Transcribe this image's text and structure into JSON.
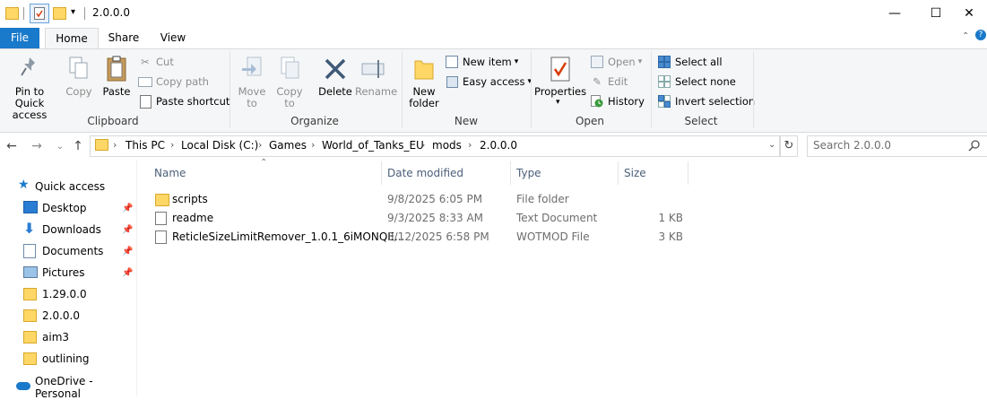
{
  "window": {
    "title": "2.0.0.0"
  },
  "ribbon_tabs": {
    "file": "File",
    "home": "Home",
    "share": "Share",
    "view": "View"
  },
  "clipboard": {
    "pin_to_quick_access": "Pin to Quick access",
    "copy": "Copy",
    "paste": "Paste",
    "cut": "Cut",
    "copy_path": "Copy path",
    "paste_shortcut": "Paste shortcut",
    "group_label": "Clipboard"
  },
  "organize": {
    "move_to": "Move to",
    "copy_to": "Copy to",
    "delete": "Delete",
    "rename": "Rename",
    "group_label": "Organize"
  },
  "new_group": {
    "new_folder": "New folder",
    "new_item": "New item",
    "easy_access": "Easy access",
    "group_label": "New"
  },
  "open_group": {
    "properties": "Properties",
    "open": "Open",
    "edit": "Edit",
    "history": "History",
    "group_label": "Open"
  },
  "select_group": {
    "select_all": "Select all",
    "select_none": "Select none",
    "invert_selection": "Invert selection",
    "group_label": "Select"
  },
  "address": {
    "crumbs": [
      "This PC",
      "Local Disk (C:)",
      "Games",
      "World_of_Tanks_EU",
      "mods",
      "2.0.0.0"
    ]
  },
  "search": {
    "placeholder": "Search 2.0.0.0"
  },
  "nav": {
    "quick_access": "Quick access",
    "items": [
      "Desktop",
      "Downloads",
      "Documents",
      "Pictures",
      "1.29.0.0",
      "2.0.0.0",
      "aim3",
      "outlining"
    ],
    "onedrive": "OneDrive - Personal"
  },
  "columns": {
    "name": "Name",
    "date": "Date modified",
    "type": "Type",
    "size": "Size"
  },
  "files": [
    {
      "name": "scripts",
      "date": "9/8/2025 6:05 PM",
      "type": "File folder",
      "size": ""
    },
    {
      "name": "readme",
      "date": "9/3/2025 8:33 AM",
      "type": "Text Document",
      "size": "1 KB"
    },
    {
      "name": "ReticleSizeLimitRemover_1.0.1_6iMONQE...",
      "date": "3/12/2025 6:58 PM",
      "type": "WOTMOD File",
      "size": "3 KB"
    }
  ],
  "colors": {
    "accent": "#1979ca",
    "folder": "#ffd766",
    "ribbon_bg": "#f5f6f7"
  },
  "window_controls": {
    "minimize": "—",
    "maximize": "☐",
    "close": "✕"
  }
}
